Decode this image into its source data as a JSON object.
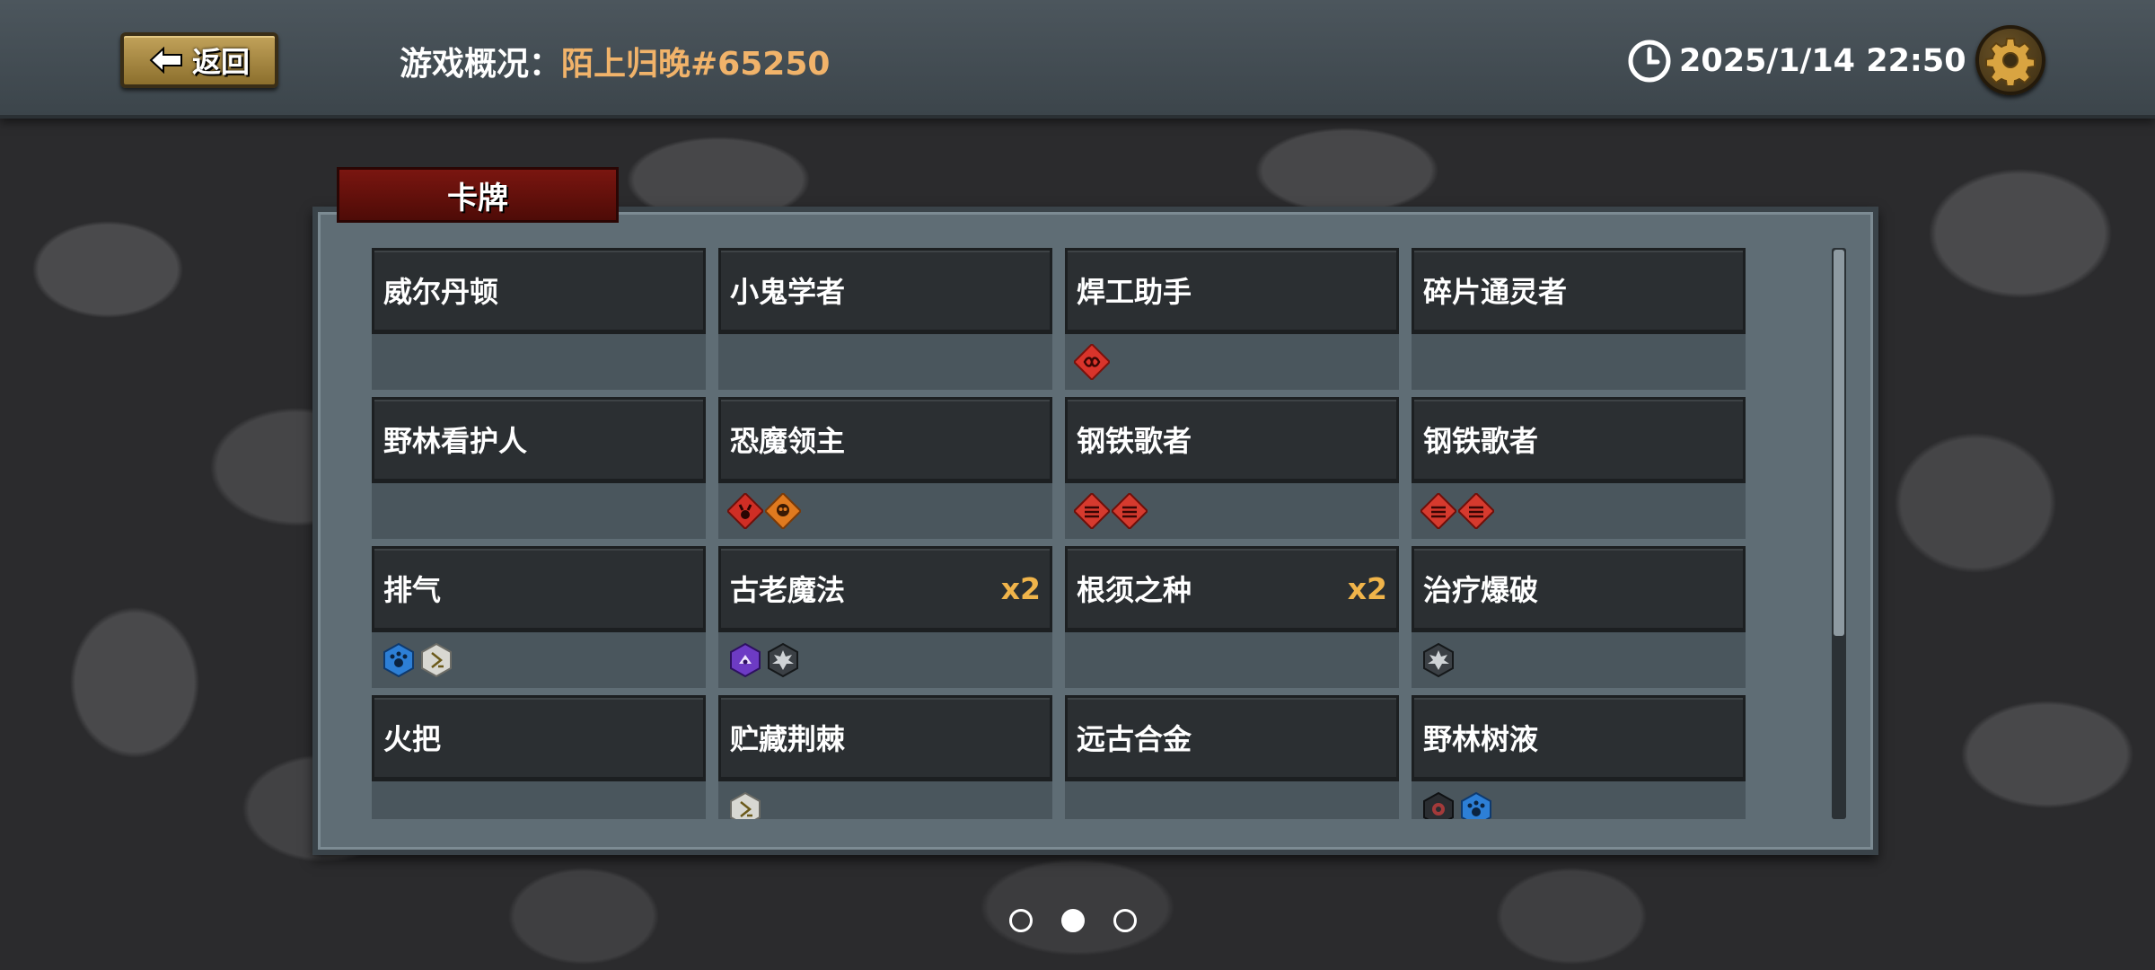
{
  "header": {
    "back_label": "返回",
    "overview_label": "游戏概况：",
    "player_name": "陌上归晚#65250",
    "timestamp": "2025/1/14 22:50"
  },
  "panel": {
    "tab_label": "卡牌",
    "cards": [
      {
        "name": "威尔丹顿",
        "count": "",
        "tags": []
      },
      {
        "name": "小鬼学者",
        "count": "",
        "tags": []
      },
      {
        "name": "焊工助手",
        "count": "",
        "tags": [
          "red-infinity-icon"
        ]
      },
      {
        "name": "碎片通灵者",
        "count": "",
        "tags": []
      },
      {
        "name": "野林看护人",
        "count": "",
        "tags": []
      },
      {
        "name": "恐魔领主",
        "count": "",
        "tags": [
          "red-demon-icon",
          "orange-skull-icon"
        ]
      },
      {
        "name": "钢铁歌者",
        "count": "",
        "tags": [
          "red-banner-icon",
          "red-banner-icon"
        ]
      },
      {
        "name": "钢铁歌者",
        "count": "",
        "tags": [
          "red-banner-icon",
          "red-banner-icon"
        ]
      },
      {
        "name": "排气",
        "count": "",
        "tags": [
          "blue-paw-icon",
          "white-rune-icon"
        ]
      },
      {
        "name": "古老魔法",
        "count": "x2",
        "tags": [
          "purple-hex-icon",
          "gray-spike-icon"
        ]
      },
      {
        "name": "根须之种",
        "count": "x2",
        "tags": []
      },
      {
        "name": "治疗爆破",
        "count": "",
        "tags": [
          "gray-spike-icon"
        ]
      },
      {
        "name": "火把",
        "count": "",
        "tags": []
      },
      {
        "name": "贮藏荆棘",
        "count": "",
        "tags": [
          "white-rune-icon"
        ]
      },
      {
        "name": "远古合金",
        "count": "",
        "tags": []
      },
      {
        "name": "野林树液",
        "count": "",
        "tags": [
          "dark-hex-icon",
          "blue-paw-icon"
        ]
      }
    ]
  },
  "pager": {
    "pages": 3,
    "active_index": 1
  },
  "colors": {
    "accent_gold": "#f1b36a",
    "count_gold": "#f0b44a",
    "tab_red": "#7a1610",
    "panel_bg": "#5f6d75"
  }
}
